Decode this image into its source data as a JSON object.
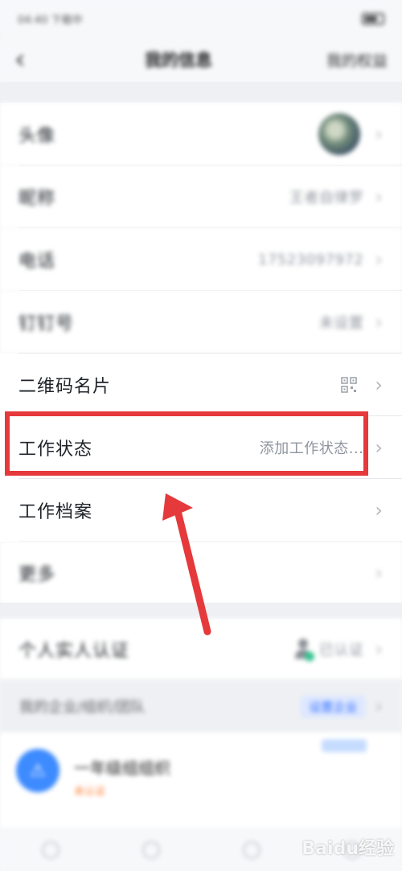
{
  "status_bar": {
    "time": "04:40 下载中",
    "battery": ""
  },
  "nav": {
    "back": "‹",
    "title": "我的信息",
    "right": "我的权益"
  },
  "profile_rows": [
    {
      "label": "头像",
      "value": ""
    },
    {
      "label": "昵称",
      "value": "王者自律罗"
    },
    {
      "label": "电话",
      "value": "17523097972"
    },
    {
      "label": "钉钉号",
      "value": "未设置"
    },
    {
      "label": "二维码名片",
      "value": ""
    },
    {
      "label": "工作状态",
      "value": "添加工作状态..."
    },
    {
      "label": "工作档案",
      "value": ""
    },
    {
      "label": "更多",
      "value": ""
    }
  ],
  "verify_row": {
    "label": "个人实人认证",
    "value": "已认证"
  },
  "org_section": {
    "title": "我的企业/组织/团队",
    "action": "设置企业"
  },
  "org": {
    "name": "一年级组组织",
    "badge": "未认证",
    "logo": "⚠"
  },
  "chevron": "›",
  "watermark": "Baidu经验",
  "colors": {
    "highlight": "#e5393b",
    "accent": "#3370ff",
    "org_badge": "#ff7a2f"
  }
}
